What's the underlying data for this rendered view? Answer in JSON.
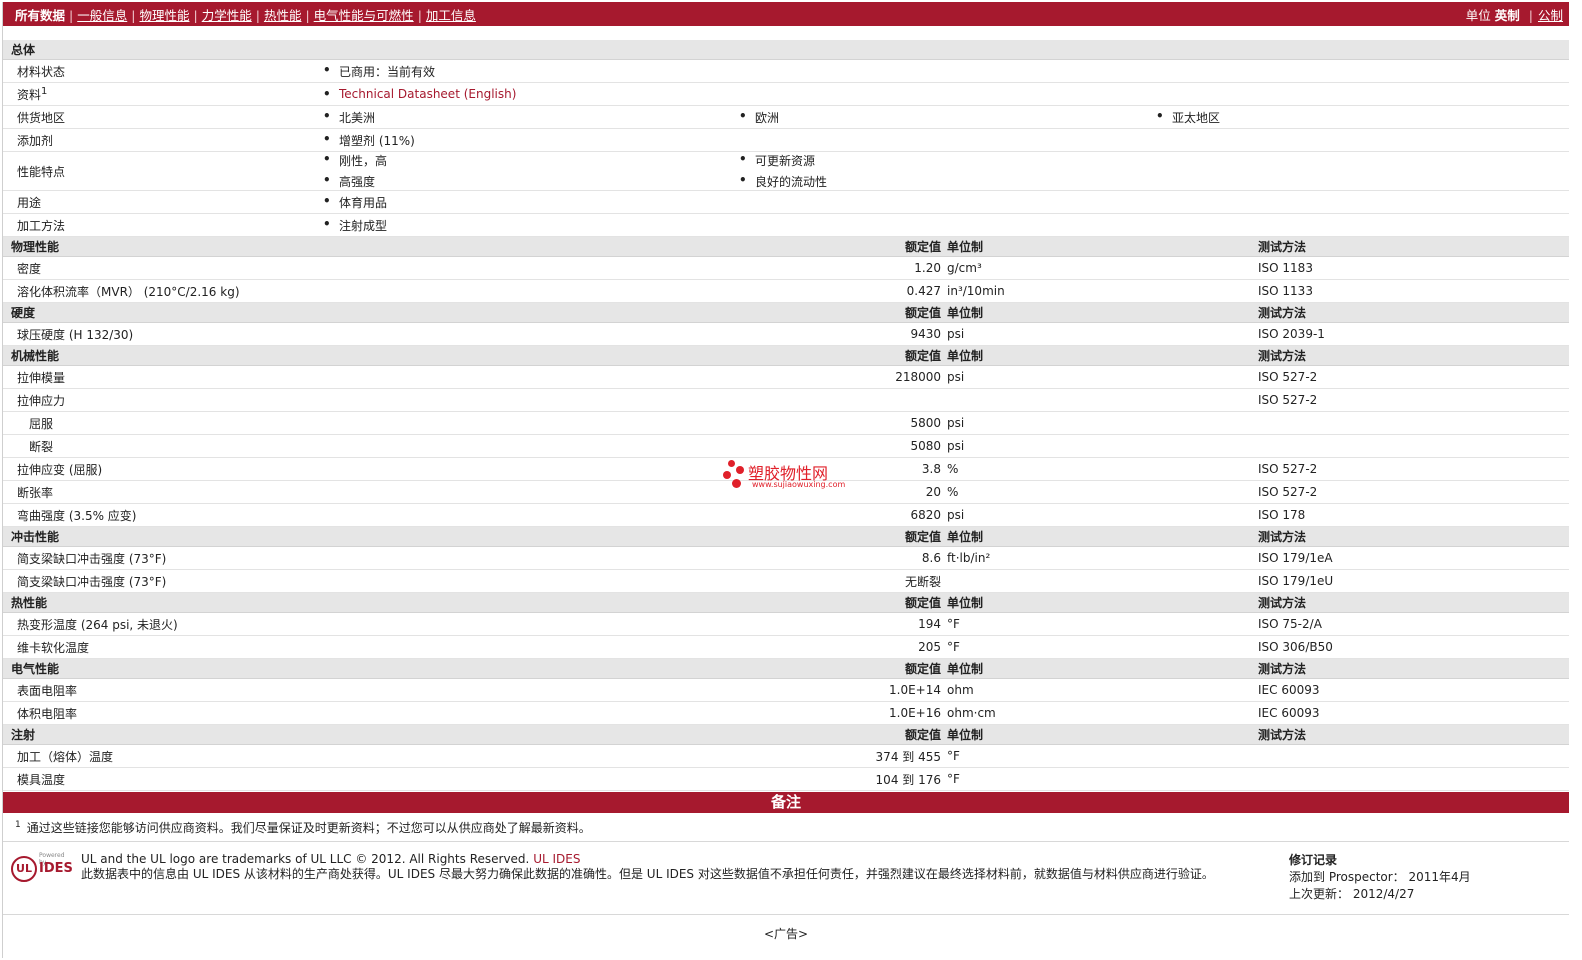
{
  "nav": {
    "all_data": "所有数据",
    "general": "一般信息",
    "physical": "物理性能",
    "mechanical": "力学性能",
    "thermal": "热性能",
    "electrical": "电气性能与可燃性",
    "processing": "加工信息",
    "units_label": "单位",
    "english": "英制",
    "metric": "公制"
  },
  "general": {
    "section": "总体",
    "status_label": "材料状态",
    "status_value": "已商用：当前有效",
    "source_label": "资料",
    "source_sup": "1",
    "source_value": "Technical Datasheet (English)",
    "region_label": "供货地区",
    "regions": [
      "北美洲",
      "欧洲",
      "亚太地区"
    ],
    "additive_label": "添加剂",
    "additive_value": "增塑剂 (11%)",
    "features_label": "性能特点",
    "features": [
      "刚性，高",
      "可更新资源",
      "高强度",
      "良好的流动性"
    ],
    "use_label": "用途",
    "use_value": "体育用品",
    "method_label": "加工方法",
    "method_value": "注射成型"
  },
  "headers": {
    "rated": "额定值",
    "unit": "单位制",
    "test": "测试方法"
  },
  "sections": {
    "physical": "物理性能",
    "hardness": "硬度",
    "mechanical": "机械性能",
    "impact": "冲击性能",
    "thermal": "热性能",
    "electrical": "电气性能",
    "injection": "注射"
  },
  "physical": [
    {
      "label": "密度",
      "value": "1.20",
      "unit": "g/cm³",
      "method": "ISO 1183"
    },
    {
      "label": "溶化体积流率（MVR） (210°C/2.16 kg)",
      "value": "0.427",
      "unit": "in³/10min",
      "method": "ISO 1133"
    }
  ],
  "hardness": [
    {
      "label": "球压硬度 (H 132/30)",
      "value": "9430",
      "unit": "psi",
      "method": "ISO 2039-1"
    }
  ],
  "mechanical": [
    {
      "label": "拉伸模量",
      "value": "218000",
      "unit": "psi",
      "method": "ISO 527-2"
    },
    {
      "label": "拉伸应力",
      "value": "",
      "unit": "",
      "method": "ISO 527-2"
    },
    {
      "label": "屈服",
      "value": "5800",
      "unit": "psi",
      "method": ""
    },
    {
      "label": "断裂",
      "value": "5080",
      "unit": "psi",
      "method": ""
    },
    {
      "label": "拉伸应变 (屈服)",
      "value": "3.8",
      "unit": "%",
      "method": "ISO 527-2"
    },
    {
      "label": "断张率",
      "value": "20",
      "unit": "%",
      "method": "ISO 527-2"
    },
    {
      "label": "弯曲强度 (3.5% 应变)",
      "value": "6820",
      "unit": "psi",
      "method": "ISO 178"
    }
  ],
  "impact": [
    {
      "label": "简支梁缺口冲击强度 (73°F)",
      "value": "8.6",
      "unit": "ft·lb/in²",
      "method": "ISO 179/1eA"
    },
    {
      "label": "简支梁缺口冲击强度 (73°F)",
      "value": "无断裂",
      "unit": "",
      "method": "ISO 179/1eU"
    }
  ],
  "thermal": [
    {
      "label": "热变形温度 (264 psi, 未退火)",
      "value": "194",
      "unit": "°F",
      "method": "ISO 75-2/A"
    },
    {
      "label": "维卡软化温度",
      "value": "205",
      "unit": "°F",
      "method": "ISO 306/B50"
    }
  ],
  "electrical": [
    {
      "label": "表面电阻率",
      "value": "1.0E+14",
      "unit": "ohm",
      "method": "IEC 60093"
    },
    {
      "label": "体积电阻率",
      "value": "1.0E+16",
      "unit": "ohm·cm",
      "method": "IEC 60093"
    }
  ],
  "injection": [
    {
      "label": "加工（熔体）温度",
      "value": "374 到  455",
      "unit": "°F",
      "method": ""
    },
    {
      "label": "模具温度",
      "value": "104 到  176",
      "unit": "°F",
      "method": ""
    }
  ],
  "notes": {
    "title": "备注",
    "sup": "1",
    "text": "通过这些链接您能够访问供应商资料。我们尽量保证及时更新资料；不过您可以从供应商处了解最新资料。"
  },
  "footer": {
    "logo_ul": "UL",
    "logo_powered": "Powered by",
    "logo_ides": "IDES",
    "trademark": "UL and the UL logo are trademarks of UL LLC © 2012. All Rights Reserved.",
    "ul_ides": "UL IDES",
    "disclaimer": "此数据表中的信息由 UL IDES 从该材料的生产商处获得。UL IDES 尽最大努力确保此数据的准确性。但是 UL IDES 对这些数据值不承担任何责任，并强烈建议在最终选择材料前，就数据值与材料供应商进行验证。",
    "rev_title": "修订记录",
    "added": "添加到 Prospector： 2011年4月",
    "updated": "上次更新： 2012/4/27",
    "ad": "<广告>"
  },
  "watermark": {
    "name": "塑胶物性网",
    "url": "www.sujiaowuxing.com"
  },
  "colors": {
    "brand": "#a6192e",
    "section_bg": "#e6e6e6",
    "watermark": "#e0202a"
  }
}
